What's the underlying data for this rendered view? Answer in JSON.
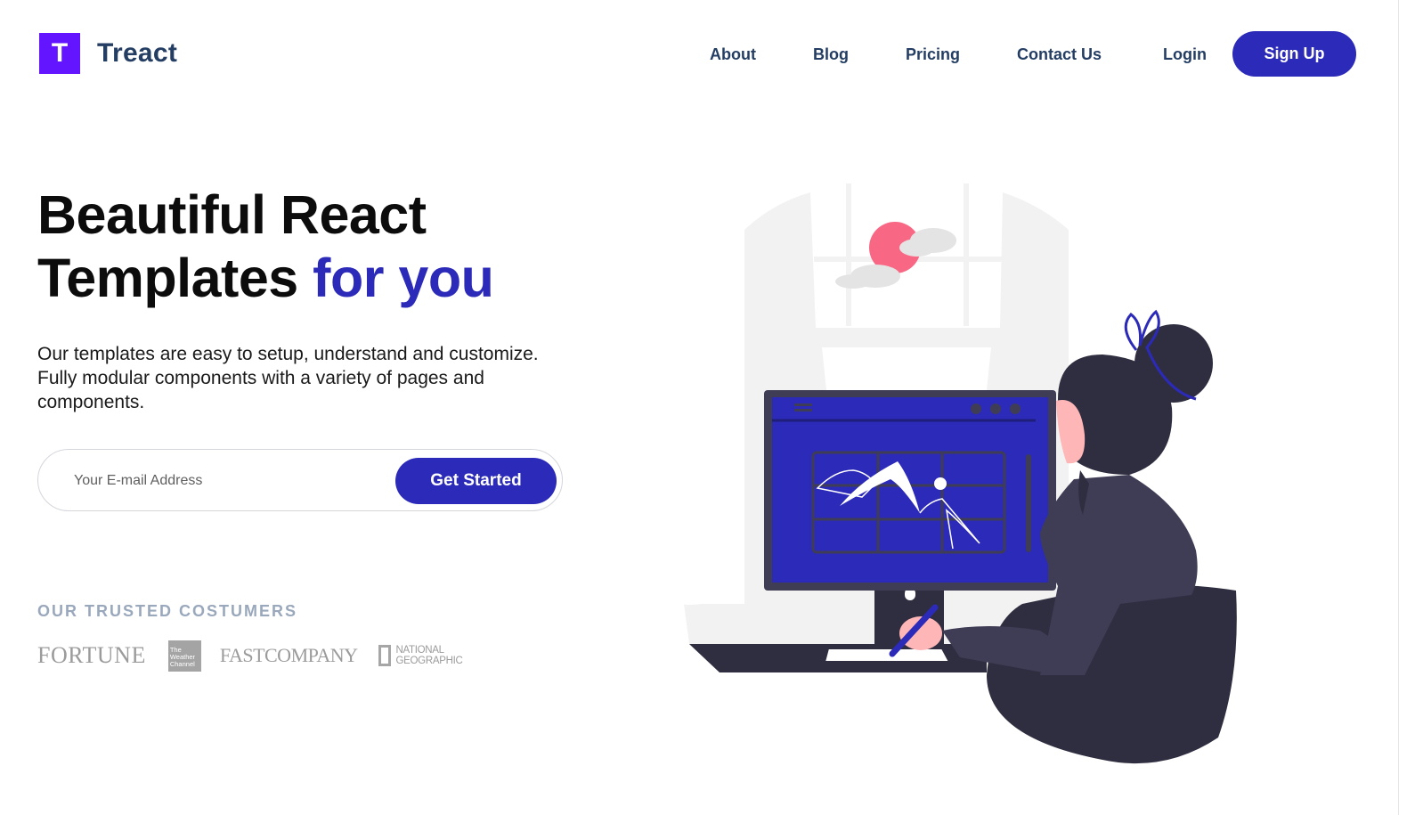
{
  "brand": {
    "mark": "T",
    "name": "Treact"
  },
  "nav": {
    "links": [
      "About",
      "Blog",
      "Pricing",
      "Contact Us"
    ],
    "login": "Login",
    "signup": "Sign Up"
  },
  "hero": {
    "title_line1": "Beautiful React",
    "title_line2": "Templates",
    "title_accent": "for you",
    "description": "Our templates are easy to setup, understand and customize. Fully modular components with a variety of pages and components.",
    "email_placeholder": "Your E-mail Address",
    "cta_label": "Get Started"
  },
  "customers": {
    "heading": "OUR TRUSTED COSTUMERS",
    "logos": {
      "fortune": "FORTUNE",
      "weather": "The Weather Channel",
      "fastcompany": "FASTCOMPANY",
      "natgeo_line1": "NATIONAL",
      "natgeo_line2": "GEOGRAPHIC"
    }
  },
  "colors": {
    "primary": "#2c2ab8",
    "logo_purple": "#6415ff",
    "nav_text": "#243e63",
    "muted": "#9aa8bc",
    "pink": "#f86884",
    "dark": "#2f2e41"
  },
  "icons": {
    "logo": "logo-icon",
    "illustration": "woman-at-computer-illustration"
  }
}
